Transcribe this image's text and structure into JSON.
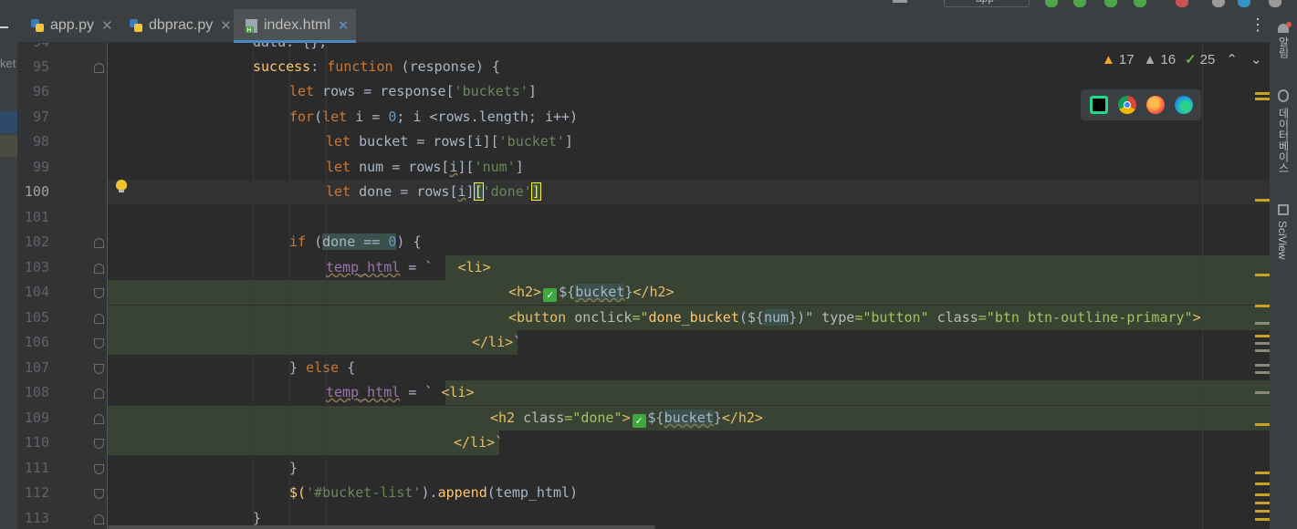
{
  "tabs": [
    {
      "label": "app.py",
      "icon": "python-file-icon",
      "active": false
    },
    {
      "label": "dbprac.py",
      "icon": "python-file-icon",
      "active": false
    },
    {
      "label": "index.html",
      "icon": "html-file-icon",
      "active": true
    }
  ],
  "left_strip": {
    "label": "ket"
  },
  "top_strip": {
    "run_config": "app"
  },
  "right_strip": {
    "labels": [
      "알림",
      "데이터베이스",
      "SciView"
    ]
  },
  "inspections": {
    "warnings": "17",
    "weak_warnings": "16",
    "typos": "25"
  },
  "browsers": [
    "pycharm-icon",
    "chrome-icon",
    "firefox-icon",
    "edge-icon"
  ],
  "editor": {
    "current_line": "100",
    "line_numbers": [
      "94",
      "95",
      "96",
      "97",
      "98",
      "99",
      "100",
      "101",
      "102",
      "103",
      "104",
      "105",
      "106",
      "107",
      "108",
      "109",
      "110",
      "111",
      "112",
      "113"
    ],
    "code": {
      "l94": {
        "t": "data: {},"
      },
      "l95": {
        "a": "success",
        "b": ": ",
        "c": "function",
        "d": " (response) {"
      },
      "l96": {
        "a": "let",
        "b": " rows = response[",
        "c": "'buckets'",
        "d": "]"
      },
      "l97": {
        "a": "for",
        "b": "(",
        "c": "let",
        "d": " i = ",
        "e": "0",
        "f": "; i <rows.length; i++)"
      },
      "l98": {
        "a": "let",
        "b": " bucket = rows[i][",
        "c": "'bucket'",
        "d": "]"
      },
      "l99": {
        "a": "let",
        "b": " num = rows[",
        "c": "i",
        "d": "][",
        "e": "'num'",
        "f": "]"
      },
      "l100": {
        "a": "let",
        "b": " done = rows[",
        "c": "i",
        "d": "]",
        "e": "[",
        "f": "'done'",
        "g": "]"
      },
      "l102": {
        "a": "if",
        "b": " (",
        "c": "done == ",
        "d": "0",
        "e": ") {"
      },
      "l103": {
        "a": "temp_html",
        "b": " = `   ",
        "c": "<li>"
      },
      "l104": {
        "a": "<h2>",
        "b": "✓",
        "c": "${",
        "d": "bucket",
        "e": "}",
        "f": "</h2>"
      },
      "l105": {
        "a": "<button",
        "b": " onclick",
        "c": "=\"",
        "d": "done_bucket",
        "e": "(${",
        "f": "num",
        "g": "})\"",
        "h": " type",
        "i": "=\"button\"",
        "j": " class",
        "k": "=\"btn btn-outline-primary\"",
        "l": ">"
      },
      "l106": {
        "a": "</li>",
        "b": "`"
      },
      "l107": {
        "a": "} ",
        "b": "else",
        "c": " {"
      },
      "l108": {
        "a": "temp_html",
        "b": " = ` ",
        "c": "<li>"
      },
      "l109": {
        "a": "<h2",
        "b": " class",
        "c": "=\"done\"",
        "d": ">",
        "e": "✓",
        "f": "${",
        "g": "bucket",
        "h": "}",
        "i": "</h2>"
      },
      "l110": {
        "a": "</li>",
        "b": "`"
      },
      "l111": {
        "t": "}"
      },
      "l112": {
        "a": "$(",
        "b": "'#bucket-list'",
        "c": ").",
        "d": "append",
        "e": "(temp_html)"
      },
      "l113": {
        "t": "}"
      }
    }
  }
}
